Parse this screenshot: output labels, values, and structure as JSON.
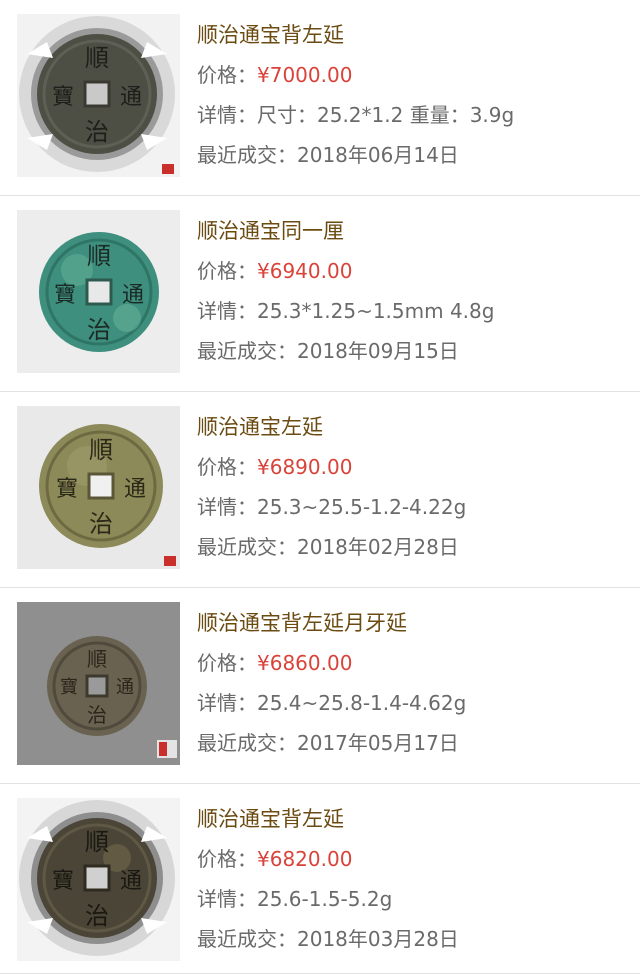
{
  "labels": {
    "price": "价格：",
    "detail": "详情：",
    "recent": "最近成交："
  },
  "items": [
    {
      "title": "顺治通宝背左延",
      "price": "¥7000.00",
      "detail": "尺寸：25.2*1.2 重量：3.9g",
      "date": "2018年06月14日",
      "coin_chars": [
        "順",
        "通",
        "治",
        "寶"
      ],
      "colors": {
        "coin": "#4d4f44",
        "rim": "#5a5a50",
        "bg": "#f2f2f2"
      }
    },
    {
      "title": "顺治通宝同一厘",
      "price": "¥6940.00",
      "detail": "25.3*1.25~1.5mm 4.8g",
      "date": "2018年09月15日",
      "coin_chars": [
        "順",
        "通",
        "治",
        "寶"
      ],
      "colors": {
        "coin": "#3e8f7e",
        "rim": "#2f7566",
        "bg": "#ededed"
      }
    },
    {
      "title": "顺治通宝左延",
      "price": "¥6890.00",
      "detail": "25.3~25.5-1.2-4.22g",
      "date": "2018年02月28日",
      "coin_chars": [
        "順",
        "通",
        "治",
        "寶"
      ],
      "colors": {
        "coin": "#8d8a5a",
        "rim": "#76734a",
        "bg": "#e9e9e9"
      }
    },
    {
      "title": "顺治通宝背左延月牙延",
      "price": "¥6860.00",
      "detail": "25.4~25.8-1.4-4.62g",
      "date": "2017年05月17日",
      "coin_chars": [
        "順",
        "通",
        "治",
        "寶"
      ],
      "colors": {
        "coin": "#6a6250",
        "rim": "#575042",
        "bg": "#8f8f8f"
      }
    },
    {
      "title": "顺治通宝背左延",
      "price": "¥6820.00",
      "detail": "25.6-1.5-5.2g",
      "date": "2018年03月28日",
      "coin_chars": [
        "順",
        "通",
        "治",
        "寶"
      ],
      "colors": {
        "coin": "#4a4536",
        "rim": "#3b3729",
        "bg": "#f3f3f3"
      }
    }
  ]
}
